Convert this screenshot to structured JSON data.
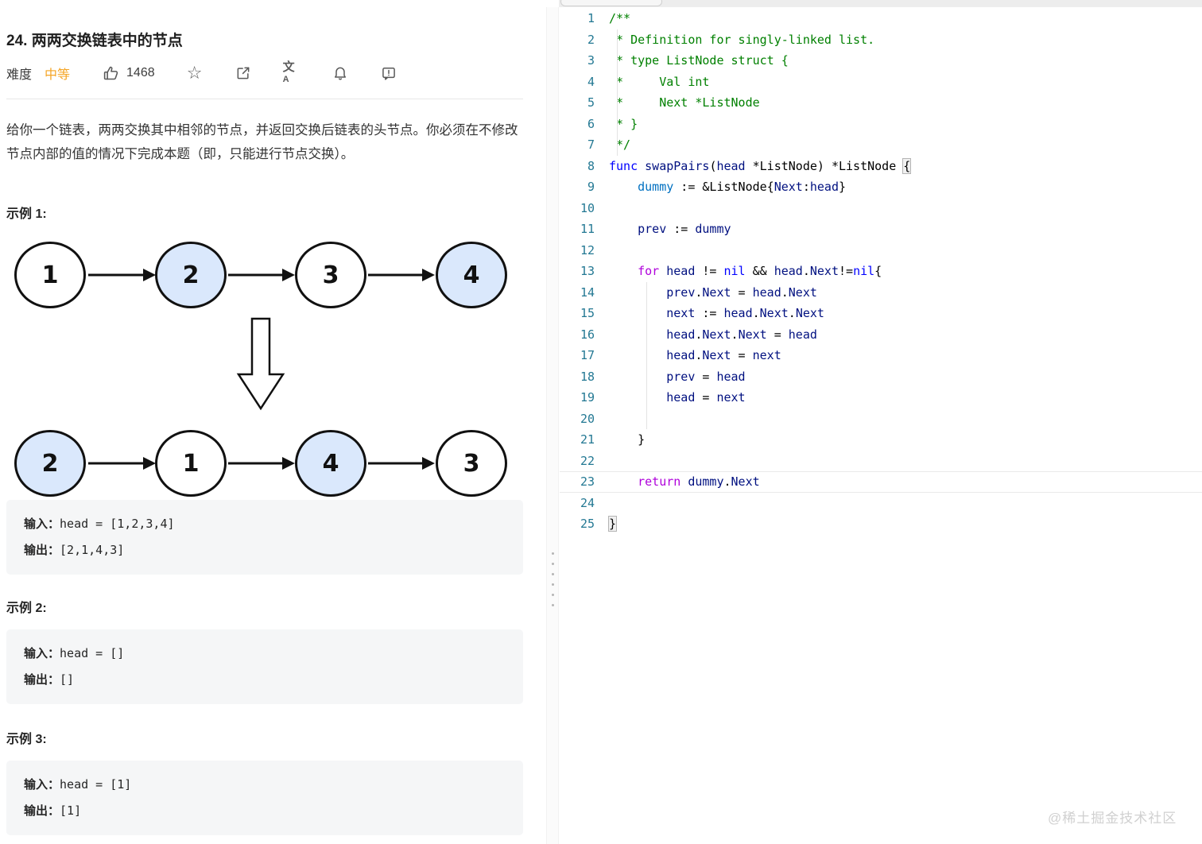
{
  "problem": {
    "title": "24. 两两交换链表中的节点",
    "difficulty_label": "难度",
    "difficulty_value": "中等",
    "like_count": "1468",
    "description": "给你一个链表，两两交换其中相邻的节点，并返回交换后链表的头节点。你必须在不修改节点内部的值的情况下完成本题（即，只能进行节点交换）。"
  },
  "icons": {
    "star_glyph": "☆",
    "translate_primary": "文",
    "translate_secondary": "A"
  },
  "examples": [
    {
      "heading": "示例 1:",
      "input_label": "输入：",
      "input_value": "head = [1,2,3,4]",
      "output_label": "输出：",
      "output_value": "[2,1,4,3]"
    },
    {
      "heading": "示例 2:",
      "input_label": "输入：",
      "input_value": "head = []",
      "output_label": "输出：",
      "output_value": "[]"
    },
    {
      "heading": "示例 3:",
      "input_label": "输入：",
      "input_value": "head = [1]",
      "output_label": "输出：",
      "output_value": "[1]"
    }
  ],
  "diagram": {
    "before_nodes": [
      {
        "value": "1",
        "highlighted": false
      },
      {
        "value": "2",
        "highlighted": true
      },
      {
        "value": "3",
        "highlighted": false
      },
      {
        "value": "4",
        "highlighted": true
      }
    ],
    "after_nodes": [
      {
        "value": "2",
        "highlighted": true
      },
      {
        "value": "1",
        "highlighted": false
      },
      {
        "value": "4",
        "highlighted": true
      },
      {
        "value": "3",
        "highlighted": false
      }
    ],
    "node_fill_highlight": "#dae8fc",
    "node_stroke": "#111111"
  },
  "editor": {
    "language": "go",
    "lines": [
      {
        "tokens": [
          [
            "/**",
            "c"
          ]
        ]
      },
      {
        "tokens": [
          [
            " * Definition for singly-linked list.",
            "c"
          ]
        ],
        "guide": 10
      },
      {
        "tokens": [
          [
            " * type ListNode struct {",
            "c"
          ]
        ],
        "guide": 10
      },
      {
        "tokens": [
          [
            " *     Val int",
            "c"
          ]
        ],
        "guide": 10
      },
      {
        "tokens": [
          [
            " *     Next *ListNode",
            "c"
          ]
        ],
        "guide": 10
      },
      {
        "tokens": [
          [
            " * }",
            "c"
          ]
        ],
        "guide": 10
      },
      {
        "tokens": [
          [
            " */",
            "c"
          ]
        ],
        "guide": 10
      },
      {
        "tokens": [
          [
            "func",
            "k"
          ],
          [
            " ",
            "p"
          ],
          [
            "swapPairs",
            "v"
          ],
          [
            "(",
            "p"
          ],
          [
            "head",
            "v"
          ],
          [
            " *ListNode) *ListNode ",
            "p"
          ],
          [
            "{",
            "b"
          ]
        ]
      },
      {
        "tokens": [
          [
            "    ",
            "p"
          ],
          [
            "dummy",
            "d"
          ],
          [
            " := &ListNode{",
            "p"
          ],
          [
            "Next",
            "v"
          ],
          [
            ":",
            "p"
          ],
          [
            "head",
            "v"
          ],
          [
            "}",
            "p"
          ]
        ]
      },
      {
        "tokens": []
      },
      {
        "tokens": [
          [
            "    ",
            "p"
          ],
          [
            "prev",
            "v"
          ],
          [
            " := ",
            "p"
          ],
          [
            "dummy",
            "v"
          ]
        ]
      },
      {
        "tokens": []
      },
      {
        "tokens": [
          [
            "    ",
            "p"
          ],
          [
            "for",
            "f"
          ],
          [
            " ",
            "p"
          ],
          [
            "head",
            "v"
          ],
          [
            " != ",
            "p"
          ],
          [
            "nil",
            "k"
          ],
          [
            " && ",
            "p"
          ],
          [
            "head",
            "v"
          ],
          [
            ".",
            "p"
          ],
          [
            "Next",
            "v"
          ],
          [
            "!=",
            "p"
          ],
          [
            "nil",
            "k"
          ],
          [
            "{",
            "p"
          ]
        ]
      },
      {
        "tokens": [
          [
            "        ",
            "p"
          ],
          [
            "prev",
            "v"
          ],
          [
            ".",
            "p"
          ],
          [
            "Next",
            "v"
          ],
          [
            " = ",
            "p"
          ],
          [
            "head",
            "v"
          ],
          [
            ".",
            "p"
          ],
          [
            "Next",
            "v"
          ]
        ],
        "guide": 47
      },
      {
        "tokens": [
          [
            "        ",
            "p"
          ],
          [
            "next",
            "v"
          ],
          [
            " := ",
            "p"
          ],
          [
            "head",
            "v"
          ],
          [
            ".",
            "p"
          ],
          [
            "Next",
            "v"
          ],
          [
            ".",
            "p"
          ],
          [
            "Next",
            "v"
          ]
        ],
        "guide": 47
      },
      {
        "tokens": [
          [
            "        ",
            "p"
          ],
          [
            "head",
            "v"
          ],
          [
            ".",
            "p"
          ],
          [
            "Next",
            "v"
          ],
          [
            ".",
            "p"
          ],
          [
            "Next",
            "v"
          ],
          [
            " = ",
            "p"
          ],
          [
            "head",
            "v"
          ]
        ],
        "guide": 47
      },
      {
        "tokens": [
          [
            "        ",
            "p"
          ],
          [
            "head",
            "v"
          ],
          [
            ".",
            "p"
          ],
          [
            "Next",
            "v"
          ],
          [
            " = ",
            "p"
          ],
          [
            "next",
            "v"
          ]
        ],
        "guide": 47
      },
      {
        "tokens": [
          [
            "        ",
            "p"
          ],
          [
            "prev",
            "v"
          ],
          [
            " = ",
            "p"
          ],
          [
            "head",
            "v"
          ]
        ],
        "guide": 47
      },
      {
        "tokens": [
          [
            "        ",
            "p"
          ],
          [
            "head",
            "v"
          ],
          [
            " = ",
            "p"
          ],
          [
            "next",
            "v"
          ]
        ],
        "guide": 47
      },
      {
        "tokens": [],
        "guide": 47
      },
      {
        "tokens": [
          [
            "    }",
            "p"
          ]
        ]
      },
      {
        "tokens": []
      },
      {
        "tokens": [
          [
            "    ",
            "p"
          ],
          [
            "return",
            "f"
          ],
          [
            " ",
            "p"
          ],
          [
            "dummy",
            "v"
          ],
          [
            ".",
            "p"
          ],
          [
            "Next",
            "v"
          ]
        ],
        "current": true
      },
      {
        "tokens": []
      },
      {
        "tokens": [
          [
            "}",
            "b"
          ]
        ]
      }
    ]
  },
  "watermark": "@稀土掘金技术社区",
  "colors": {
    "difficulty_orange": "#f5a526",
    "line_number_blue": "#237893",
    "comment_green": "#008000",
    "keyword_blue": "#0000ff",
    "control_purple": "#af00db",
    "variable_navy": "#001080",
    "node_highlight_blue": "#dae8fc",
    "example_box_gray": "#f5f6f7"
  }
}
